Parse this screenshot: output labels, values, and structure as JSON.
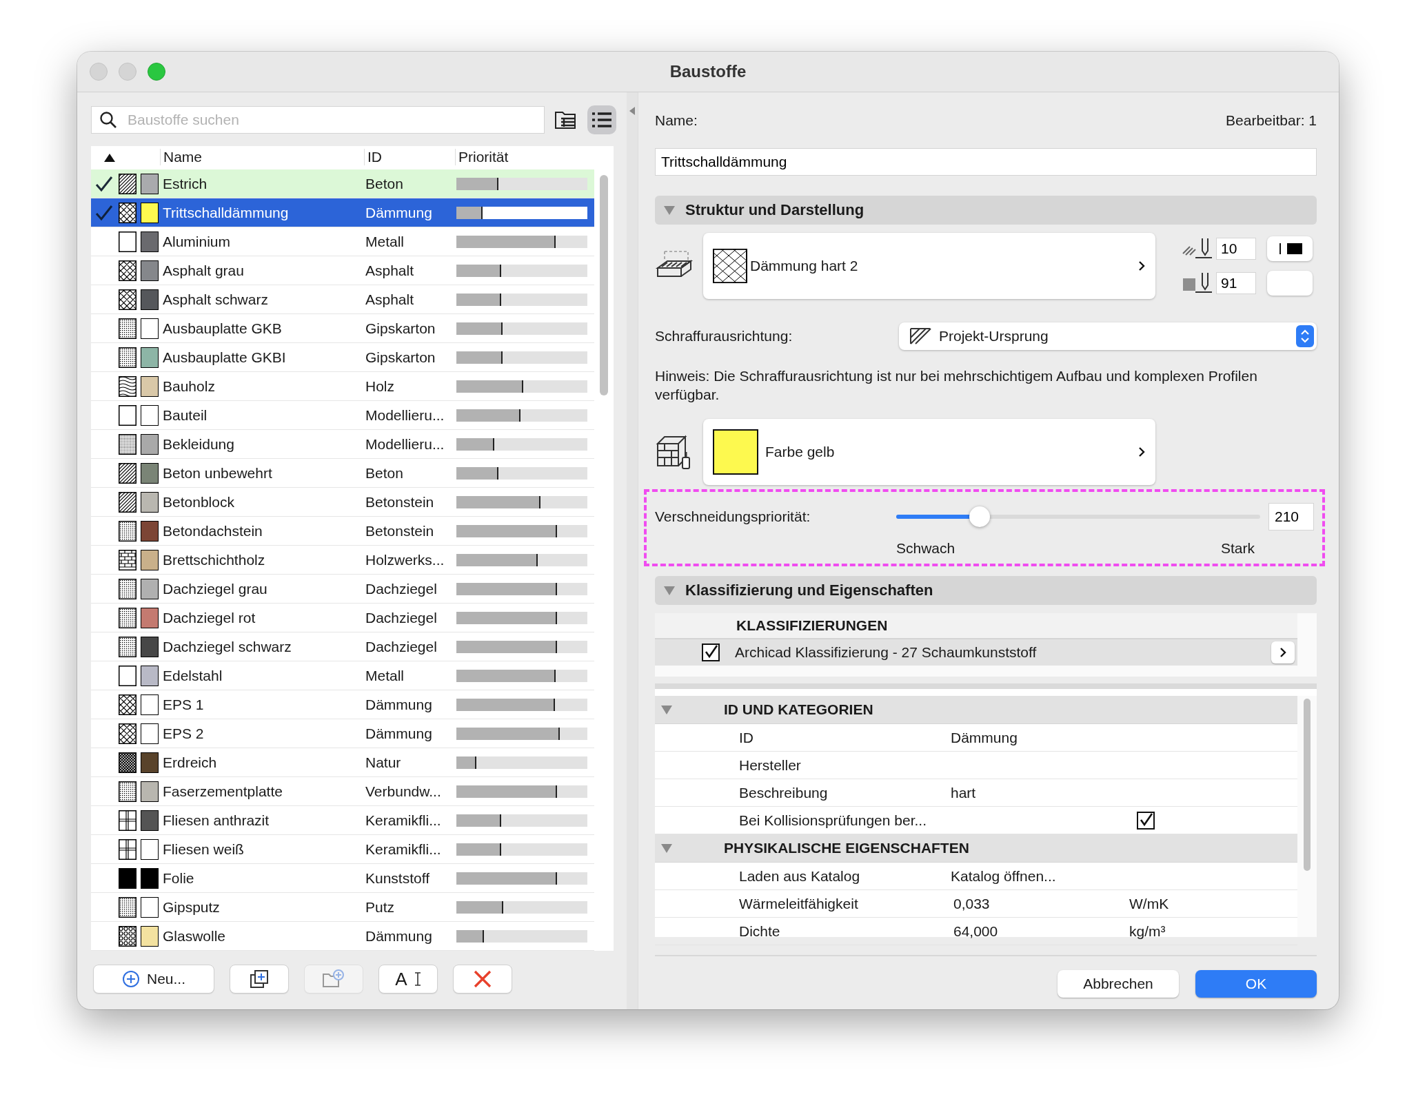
{
  "window": {
    "title": "Baustoffe"
  },
  "search": {
    "placeholder": "Baustoffe suchen"
  },
  "view_buttons": [
    {
      "kind": "folder",
      "selected": false
    },
    {
      "kind": "list",
      "selected": true
    }
  ],
  "table": {
    "columns": [
      "Name",
      "ID",
      "Priorität"
    ],
    "rows": [
      {
        "name": "Estrich",
        "id": "Beton",
        "level": 0.32,
        "checked": true,
        "selected": false,
        "highlighted": true,
        "kind": "diagonal",
        "color": "#a9aaad"
      },
      {
        "name": "Trittschalldämmung",
        "id": "Dämmung",
        "level": 0.2,
        "checked": true,
        "selected": true,
        "highlighted": false,
        "kind": "cross",
        "color": "#fdf94f"
      },
      {
        "name": "Aluminium",
        "id": "Metall",
        "level": 0.76,
        "checked": false,
        "selected": false,
        "highlighted": false,
        "kind": "none",
        "color": "#6a6a6e"
      },
      {
        "name": "Asphalt grau",
        "id": "Asphalt",
        "level": 0.34,
        "checked": false,
        "selected": false,
        "highlighted": false,
        "kind": "cross",
        "color": "#85878b"
      },
      {
        "name": "Asphalt schwarz",
        "id": "Asphalt",
        "level": 0.34,
        "checked": false,
        "selected": false,
        "highlighted": false,
        "kind": "cross",
        "color": "#55575b"
      },
      {
        "name": "Ausbauplatte GKB",
        "id": "Gipskarton",
        "level": 0.35,
        "checked": false,
        "selected": false,
        "highlighted": false,
        "kind": "dots",
        "color": "#ffffff"
      },
      {
        "name": "Ausbauplatte GKBI",
        "id": "Gipskarton",
        "level": 0.35,
        "checked": false,
        "selected": false,
        "highlighted": false,
        "kind": "dots",
        "color": "#8db5a6"
      },
      {
        "name": "Bauholz",
        "id": "Holz",
        "level": 0.51,
        "checked": false,
        "selected": false,
        "highlighted": false,
        "kind": "wood",
        "color": "#d9c8a8"
      },
      {
        "name": "Bauteil",
        "id": "Modellieru...",
        "level": 0.49,
        "checked": false,
        "selected": false,
        "highlighted": false,
        "kind": "none",
        "color": "#ffffff"
      },
      {
        "name": "Bekleidung",
        "id": "Modellieru...",
        "level": 0.29,
        "checked": false,
        "selected": false,
        "highlighted": false,
        "kind": "dense",
        "color": "#a9a9a9"
      },
      {
        "name": "Beton unbewehrt",
        "id": "Beton",
        "level": 0.32,
        "checked": false,
        "selected": false,
        "highlighted": false,
        "kind": "diagonal",
        "color": "#7a8476"
      },
      {
        "name": "Betonblock",
        "id": "Betonstein",
        "level": 0.64,
        "checked": false,
        "selected": false,
        "highlighted": false,
        "kind": "diagonal",
        "color": "#b9b7b0"
      },
      {
        "name": "Betondachstein",
        "id": "Betonstein",
        "level": 0.77,
        "checked": false,
        "selected": false,
        "highlighted": false,
        "kind": "dots",
        "color": "#7c4535"
      },
      {
        "name": "Brettschichtholz",
        "id": "Holzwerks...",
        "level": 0.62,
        "checked": false,
        "selected": false,
        "highlighted": false,
        "kind": "brick",
        "color": "#c9b08a"
      },
      {
        "name": "Dachziegel grau",
        "id": "Dachziegel",
        "level": 0.77,
        "checked": false,
        "selected": false,
        "highlighted": false,
        "kind": "dots",
        "color": "#b0b0b0"
      },
      {
        "name": "Dachziegel rot",
        "id": "Dachziegel",
        "level": 0.77,
        "checked": false,
        "selected": false,
        "highlighted": false,
        "kind": "dots",
        "color": "#c47a70"
      },
      {
        "name": "Dachziegel schwarz",
        "id": "Dachziegel",
        "level": 0.77,
        "checked": false,
        "selected": false,
        "highlighted": false,
        "kind": "dots",
        "color": "#474747"
      },
      {
        "name": "Edelstahl",
        "id": "Metall",
        "level": 0.76,
        "checked": false,
        "selected": false,
        "highlighted": false,
        "kind": "none",
        "color": "#b8b9c6"
      },
      {
        "name": "EPS 1",
        "id": "Dämmung",
        "level": 0.75,
        "checked": false,
        "selected": false,
        "highlighted": false,
        "kind": "cross",
        "color": "#ffffff"
      },
      {
        "name": "EPS 2",
        "id": "Dämmung",
        "level": 0.79,
        "checked": false,
        "selected": false,
        "highlighted": false,
        "kind": "cross",
        "color": "#ffffff"
      },
      {
        "name": "Erdreich",
        "id": "Natur",
        "level": 0.15,
        "checked": false,
        "selected": false,
        "highlighted": false,
        "kind": "hatch",
        "color": "#59432b"
      },
      {
        "name": "Faserzementplatte",
        "id": "Verbundw...",
        "level": 0.77,
        "checked": false,
        "selected": false,
        "highlighted": false,
        "kind": "dots",
        "color": "#b8b6af"
      },
      {
        "name": "Fliesen anthrazit",
        "id": "Keramikfli...",
        "level": 0.34,
        "checked": false,
        "selected": false,
        "highlighted": false,
        "kind": "grid",
        "color": "#545454"
      },
      {
        "name": "Fliesen weiß",
        "id": "Keramikfli...",
        "level": 0.34,
        "checked": false,
        "selected": false,
        "highlighted": false,
        "kind": "grid",
        "color": "#ffffff"
      },
      {
        "name": "Folie",
        "id": "Kunststoff",
        "level": 0.77,
        "checked": false,
        "selected": false,
        "highlighted": false,
        "kind": "solid",
        "color": "#000000"
      },
      {
        "name": "Gipsputz",
        "id": "Putz",
        "level": 0.36,
        "checked": false,
        "selected": false,
        "highlighted": false,
        "kind": "dots",
        "color": "#ffffff"
      },
      {
        "name": "Glaswolle",
        "id": "Dämmung",
        "level": 0.21,
        "checked": false,
        "selected": false,
        "highlighted": false,
        "kind": "wool",
        "color": "#f3e2a0"
      }
    ]
  },
  "list_buttons": [
    {
      "kind": "new",
      "label": "Neu...",
      "disabled": false
    },
    {
      "kind": "duplicate",
      "disabled": false
    },
    {
      "kind": "add-folder",
      "disabled": true
    },
    {
      "kind": "rename",
      "label": "A",
      "disabled": false
    },
    {
      "kind": "delete",
      "disabled": false
    }
  ],
  "editor": {
    "name_label": "Name:",
    "editable": "Bearbeitbar: 1",
    "name_value": "Trittschalldämmung"
  },
  "structure": {
    "title": "Struktur und Darstellung",
    "expanded": true,
    "fill": {
      "kind": "cross",
      "label": "Dämmung hart 2"
    },
    "line_pen": "10",
    "background_pen": "91",
    "orientation_label": "Schraffurausrichtung:",
    "orientation_value": "Projekt-Ursprung",
    "hint": "Hinweis: Die Schraffurausrichtung ist nur bei mehrschichtigem Aufbau und komplexen Profilen verfügbar.",
    "surface": {
      "label": "Farbe gelb"
    },
    "priority": {
      "label": "Verschneidungspriorität:",
      "level": 0.23,
      "value": "210",
      "min_label": "Schwach",
      "max_label": "Stark"
    }
  },
  "classification": {
    "title": "Klassifizierung und Eigenschaften",
    "expanded": true,
    "heading": "KLASSIFIZIERUNGEN",
    "items": [
      {
        "label": "Archicad Klassifizierung - 27 Schaumkunststoff",
        "checked": true
      }
    ],
    "groups": [
      {
        "title": "ID UND KATEGORIEN",
        "expanded": true,
        "rows": [
          {
            "kind": "text",
            "name": "ID",
            "value": "Dämmung"
          },
          {
            "kind": "text",
            "name": "Hersteller"
          },
          {
            "kind": "text",
            "name": "Beschreibung",
            "value": "hart"
          },
          {
            "kind": "checkbox",
            "name": "Bei Kollisionsprüfungen ber...",
            "checked": true
          }
        ]
      },
      {
        "title": "PHYSIKALISCHE EIGENSCHAFTEN",
        "expanded": true,
        "rows": [
          {
            "kind": "text",
            "name": "Laden aus Katalog",
            "value": "Katalog öffnen..."
          },
          {
            "kind": "text",
            "name": "Wärmeleitfähigkeit",
            "value": "0,033",
            "unit": "W/mK"
          },
          {
            "kind": "text",
            "name": "Dichte",
            "value": "64,000",
            "unit": "kg/m³"
          }
        ]
      }
    ]
  },
  "buttons": [
    {
      "label": "Abbrechen",
      "default": false
    },
    {
      "label": "OK",
      "default": true
    }
  ]
}
